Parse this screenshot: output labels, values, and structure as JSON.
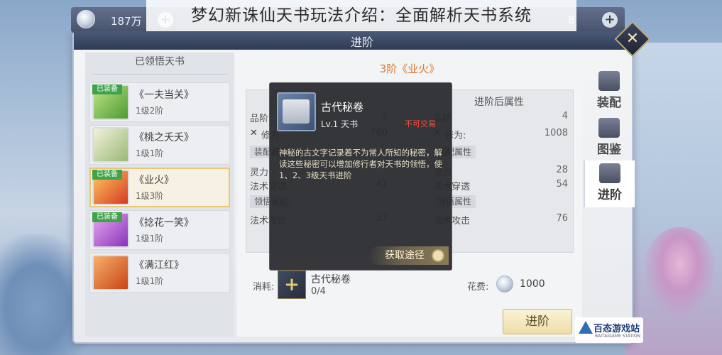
{
  "caption": "梦幻新诛仙天书玩法介绍：全面解析天书系统",
  "topbar": {
    "currency": "187万",
    "right_value": "8"
  },
  "window": {
    "title": "进阶"
  },
  "left_panel": {
    "header": "已领悟天书",
    "items": [
      {
        "name": "《一夫当关》",
        "level": "1级2阶",
        "tag": "已装备",
        "color": "#7fc043"
      },
      {
        "name": "《桃之夭夭》",
        "level": "1级1阶",
        "tag": "",
        "color": "#c7d58b"
      },
      {
        "name": "《业火》",
        "level": "1级3阶",
        "tag": "已装备",
        "color": "#e0552c"
      },
      {
        "name": "《捻花一笑》",
        "level": "1级1阶",
        "tag": "已装备",
        "color": "#b35ad6"
      },
      {
        "name": "《满江红》",
        "level": "1级1阶",
        "tag": "",
        "color": "#e0632c"
      }
    ]
  },
  "tabs": [
    {
      "label": "装配",
      "icon": "book-icon"
    },
    {
      "label": "图鉴",
      "icon": "book-open-icon"
    },
    {
      "label": "进阶",
      "icon": "lotus-icon"
    }
  ],
  "main": {
    "stage_title": "3阶《业火》",
    "before": {
      "header": "",
      "rows": [
        {
          "label": "品阶",
          "value": "3"
        },
        {
          "label": "修为",
          "value": "760"
        }
      ],
      "equip_tag": "装配属性",
      "equip_rows": [
        {
          "label": "灵力",
          "value": ""
        },
        {
          "label": "法术穿透",
          "value": "41"
        }
      ],
      "comp_tag": "领悟属性",
      "comp_rows": [
        {
          "label": "法术攻击",
          "value": "57"
        }
      ]
    },
    "after": {
      "header": "进阶后属性",
      "rows": [
        {
          "label": "品阶",
          "value": "4"
        },
        {
          "label": "修为:",
          "value": "1008"
        }
      ],
      "equip_tag": "装配属性",
      "equip_rows": [
        {
          "label": "灵力",
          "value": "28"
        },
        {
          "label": "法术穿透",
          "value": "54"
        }
      ],
      "comp_tag": "领悟属性",
      "comp_rows": [
        {
          "label": "法术攻击",
          "value": "76"
        }
      ]
    },
    "cost": {
      "label": "消耗:",
      "item_name": "古代秘卷",
      "count": "0/4"
    },
    "fee": {
      "label": "花费:",
      "value": "1000"
    },
    "advance_button": "进阶"
  },
  "tooltip": {
    "name": "古代秘卷",
    "level": "Lv.1 天书",
    "trade": "不可交易",
    "description": "神秘的古文字记录着不为常人所知的秘密，解读这些秘密可以增加修行者对天书的领悟，使1、2、3级天书进阶",
    "button": "获取途径"
  },
  "watermark": {
    "text": "百态游戏站",
    "sub": "BAITAIGAME STATION"
  }
}
